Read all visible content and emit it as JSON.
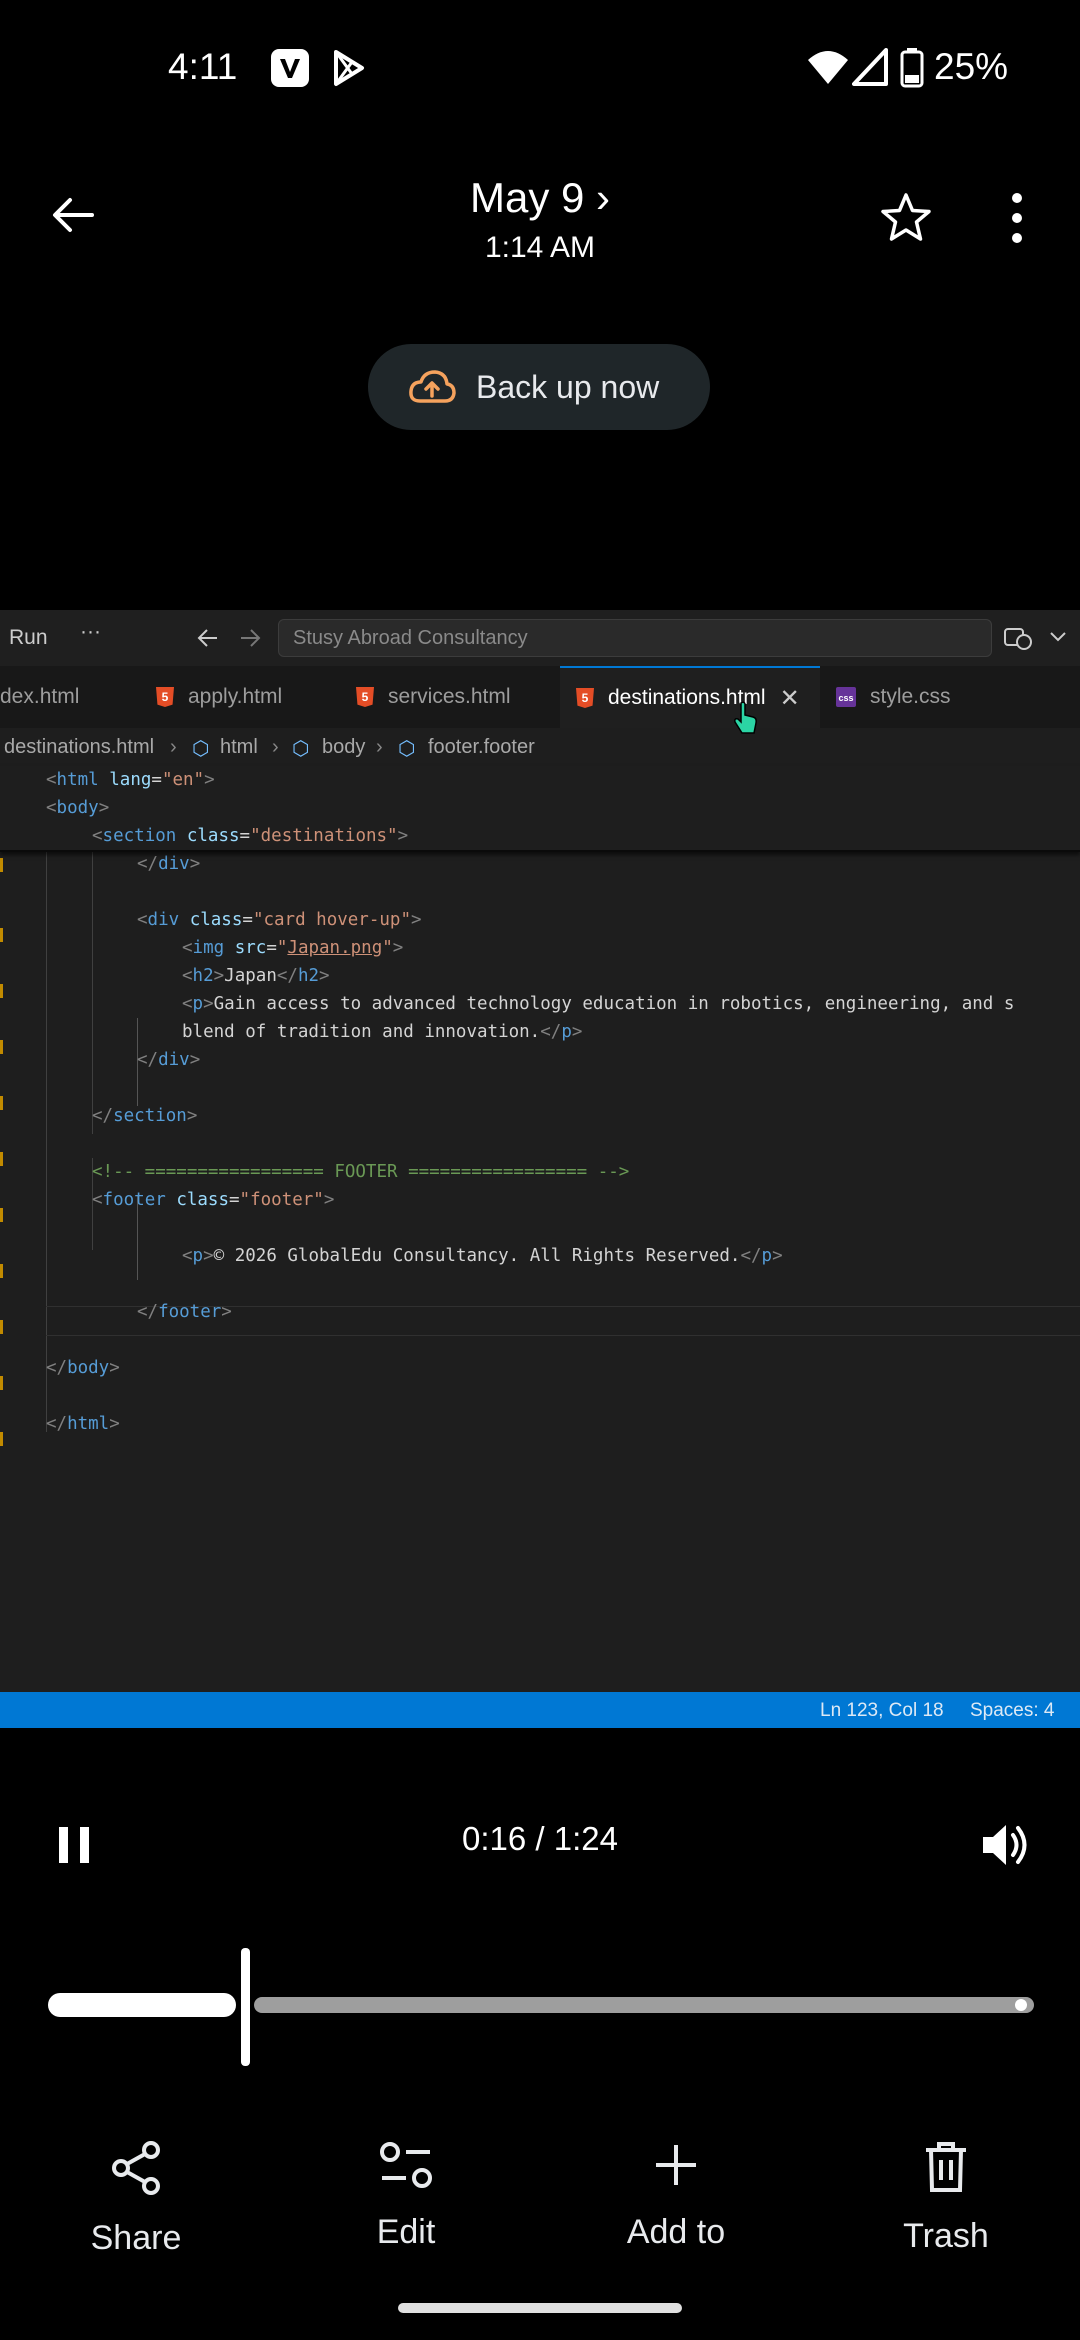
{
  "status_bar": {
    "time": "4:11",
    "battery": "25%",
    "icons": [
      "vpn-app-icon",
      "play-store-icon",
      "wifi-icon",
      "signal-icon",
      "battery-icon"
    ]
  },
  "header": {
    "title": "May 9 ›",
    "subtitle": "1:14 AM",
    "backup_label": "Back up now",
    "accent": "#f5a25d"
  },
  "editor": {
    "run_menu": "Run",
    "more": "···",
    "search_placeholder": "Stusy Abroad Consultancy",
    "tabs": [
      {
        "label": "index.html",
        "shown": "dex.html",
        "type": "html"
      },
      {
        "label": "apply.html",
        "type": "html"
      },
      {
        "label": "services.html",
        "type": "html"
      },
      {
        "label": "destinations.html",
        "type": "html",
        "active": true
      },
      {
        "label": "style.css",
        "type": "css"
      }
    ],
    "breadcrumb": [
      "destinations.html",
      "html",
      "body",
      "footer.footer"
    ],
    "code_lines": [
      "<html lang=\"en\">",
      "<body>",
      "<section class=\"destinations\">",
      "</div>",
      "<div class=\"card hover-up\">",
      "<img src=\"Japan.png\">",
      "<h2>Japan</h2>",
      "<p>Gain access to advanced technology education in robotics, engineering, and s",
      "blend of tradition and innovation.</p>",
      "</div>",
      "</section>",
      "<!-- ================= FOOTER ================= -->",
      "<footer class=\"footer\">",
      "<p>© 2026 GlobalEdu Consultancy. All Rights Reserved.</p>",
      "</footer>",
      "</body>",
      "</html>"
    ],
    "status": {
      "position": "Ln 123, Col 18",
      "spaces": "Spaces: 4"
    },
    "accent": "#0078d4"
  },
  "video": {
    "time": "0:16 / 1:24",
    "progress": 0.19
  },
  "actions": [
    {
      "label": "Share",
      "icon": "share-icon"
    },
    {
      "label": "Edit",
      "icon": "edit-sliders-icon"
    },
    {
      "label": "Add to",
      "icon": "plus-icon"
    },
    {
      "label": "Trash",
      "icon": "trash-icon"
    }
  ]
}
